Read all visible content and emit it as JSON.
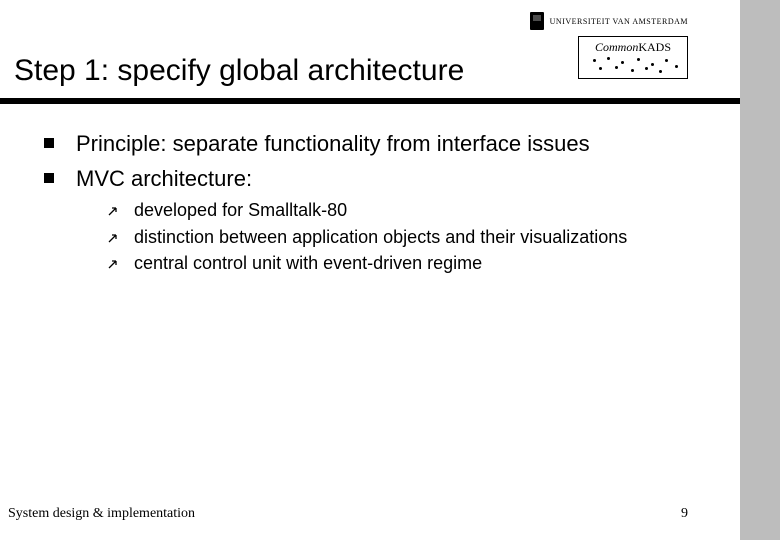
{
  "header": {
    "uni_name": "UNIVERSITEIT VAN AMSTERDAM",
    "kads_prefix": "Common",
    "kads_suffix": "KADS"
  },
  "title": "Step 1: specify global architecture",
  "bullets": [
    "Principle: separate functionality from interface issues",
    "MVC architecture:"
  ],
  "sub_bullets": [
    "developed for Smalltalk-80",
    "distinction between application objects and their visualizations",
    "central control unit with event-driven regime"
  ],
  "footer": {
    "left": "System design & implementation",
    "page": "9"
  }
}
